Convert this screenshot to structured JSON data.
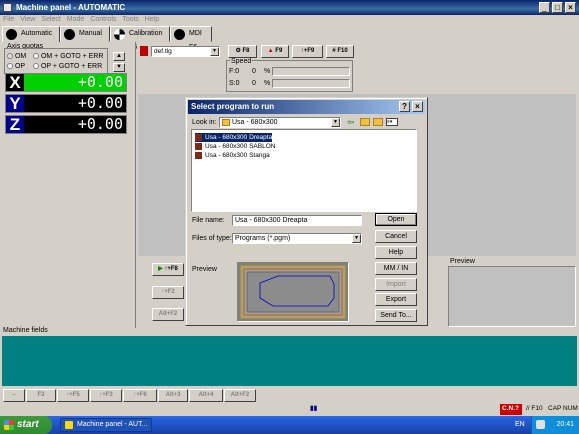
{
  "window": {
    "title": "Machine panel - AUTOMATIC",
    "minimize": "_",
    "maximize": "□",
    "close": "×"
  },
  "menu": [
    "File",
    "View",
    "Select",
    "Mode",
    "Controls",
    "Tools",
    "Help"
  ],
  "tabs": [
    {
      "label": "Automatic F2",
      "icon": "auto-icon"
    },
    {
      "label": "Manual F4",
      "icon": "manual-icon"
    },
    {
      "label": "Calibration F5",
      "icon": "calibration-icon"
    },
    {
      "label": "MDI F6",
      "icon": "mdi-icon"
    }
  ],
  "axis_quotas": {
    "label": "Axis quotas",
    "radios": [
      "OM",
      "OM + GOTO + ERR",
      "OP",
      "OP + GOTO + ERR"
    ],
    "axes": [
      {
        "name": "X",
        "value": "+0.00"
      },
      {
        "name": "Y",
        "value": "+0.00"
      },
      {
        "name": "Z",
        "value": "+0.00"
      }
    ]
  },
  "program_select": {
    "value": "def.tlg"
  },
  "fkeys": {
    "f8": "F8",
    "f9": "F9",
    "shift_f9": "↑+F9",
    "f10": "F10",
    "hash": "#"
  },
  "speed": {
    "label": "Speed",
    "f_label": "F:0",
    "f_val": "0",
    "f_unit": "%",
    "s_label": "S:0",
    "s_val": "0",
    "s_unit": "%"
  },
  "left_buttons": {
    "shift_f8": "↑+F8",
    "shift_f2": "↑+F2",
    "alt_f2": "Alt+F2"
  },
  "preview_label": "Preview",
  "machine_fields": "Machine fields",
  "bottom_buttons": [
    "F3",
    "↑+F5",
    "↑+F3",
    "↑+F6",
    "Alt+3",
    "Alt+4",
    "Alt+F2"
  ],
  "dialog": {
    "title": "Select program to run",
    "help": "?",
    "close": "×",
    "look_in_label": "Look in:",
    "look_in_value": "Usa - 680x300",
    "files": [
      "Usa - 680x300 Dreapta",
      "Usa - 680x300 SABLON",
      "Usa - 680x300 Stanga"
    ],
    "selected_file": 0,
    "file_name_label": "File name:",
    "file_name_value": "Usa - 680x300 Dreapta",
    "file_type_label": "Files of type:",
    "file_type_value": "Programs (*.pgm)",
    "preview_label": "Preview",
    "buttons": {
      "open": "Open",
      "cancel": "Cancel",
      "help": "Help",
      "mm_in": "MM / IN",
      "import": "Import",
      "export": "Export",
      "send_to": "Send To..."
    }
  },
  "status": {
    "cnc": "C.N.?",
    "f10": "// F10",
    "cap": "CAP",
    "num": "NUM"
  },
  "taskbar": {
    "start": "start",
    "task": "Machine panel - AUT...",
    "lang": "EN",
    "clock": "20:41"
  },
  "colors": {
    "title": "#0a246a",
    "dro_green": "#00c000",
    "dro_black": "#000000",
    "teal": "#008080",
    "cnc_red": "#d00000"
  }
}
